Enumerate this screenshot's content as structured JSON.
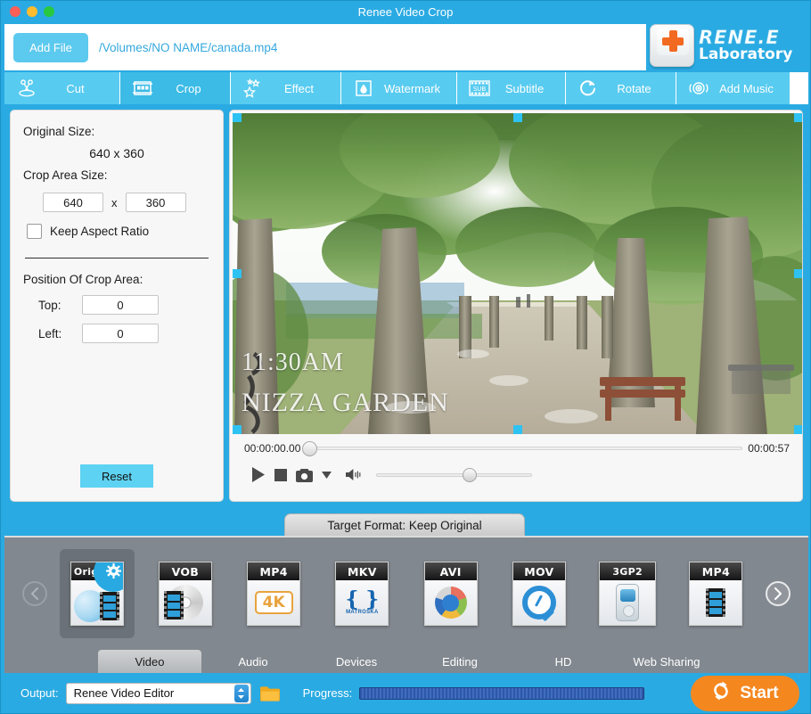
{
  "window": {
    "title": "Renee Video Crop",
    "traffic_lights": [
      "close",
      "minimize",
      "zoom"
    ]
  },
  "filebar": {
    "add_file_label": "Add File",
    "file_path": "/Volumes/NO NAME/canada.mp4"
  },
  "logo": {
    "brand": "RENE.E",
    "subtitle": "Laboratory"
  },
  "nav_tabs": [
    {
      "label": "Cut",
      "icon": "scissors-icon",
      "active": false
    },
    {
      "label": "Crop",
      "icon": "crop-frame-icon",
      "active": true
    },
    {
      "label": "Effect",
      "icon": "stars-icon",
      "active": false
    },
    {
      "label": "Watermark",
      "icon": "watermark-drop-icon",
      "active": false
    },
    {
      "label": "Subtitle",
      "icon": "subtitle-film-icon",
      "active": false
    },
    {
      "label": "Rotate",
      "icon": "rotate-arrow-icon",
      "active": false
    },
    {
      "label": "Add Music",
      "icon": "audio-waves-icon",
      "active": false
    }
  ],
  "crop_panel": {
    "original_size_label": "Original Size:",
    "original_size_value": "640 x 360",
    "crop_area_size_label": "Crop Area Size:",
    "crop_width": "640",
    "crop_height": "360",
    "dimension_separator": "x",
    "keep_aspect_ratio_label": "Keep Aspect Ratio",
    "keep_aspect_ratio_checked": false,
    "position_label": "Position Of Crop Area:",
    "top_label": "Top:",
    "top_value": "0",
    "left_label": "Left:",
    "left_value": "0",
    "reset_label": "Reset"
  },
  "preview": {
    "overlay_time": "11:30AM",
    "overlay_place": "NIZZA GARDEN",
    "current_time": "00:00:00.00",
    "total_time": "00:00:57",
    "seek_position_percent": 0,
    "volume_percent": 55,
    "controls": [
      {
        "name": "play-button",
        "icon": "play-icon"
      },
      {
        "name": "stop-button",
        "icon": "stop-icon"
      },
      {
        "name": "snapshot-button",
        "icon": "camera-icon"
      },
      {
        "name": "snapshot-menu",
        "icon": "chevron-down-icon"
      },
      {
        "name": "volume-button",
        "icon": "speaker-icon"
      }
    ]
  },
  "target_format": {
    "tab_label": "Target Format: Keep Original",
    "prev_arrow": "chevron-left-icon",
    "next_arrow": "chevron-right-icon",
    "items": [
      {
        "label": "Original",
        "selected": true,
        "badge": "gear-icon",
        "art": "globe-film"
      },
      {
        "label": "VOB",
        "selected": false,
        "badge": "",
        "art": "disc-film"
      },
      {
        "label": "MP4",
        "selected": false,
        "badge": "",
        "art": "4k"
      },
      {
        "label": "MKV",
        "selected": false,
        "badge": "",
        "art": "matroska"
      },
      {
        "label": "AVI",
        "selected": false,
        "badge": "",
        "art": "color-wheel"
      },
      {
        "label": "MOV",
        "selected": false,
        "badge": "",
        "art": "quicktime"
      },
      {
        "label": "3GP2",
        "selected": false,
        "badge": "",
        "art": "handheld"
      },
      {
        "label": "MP4",
        "selected": false,
        "badge": "",
        "art": "film"
      }
    ]
  },
  "category_tabs": [
    {
      "label": "Video",
      "active": true
    },
    {
      "label": "Audio",
      "active": false
    },
    {
      "label": "Devices",
      "active": false
    },
    {
      "label": "Editing",
      "active": false
    },
    {
      "label": "HD",
      "active": false
    },
    {
      "label": "Web Sharing",
      "active": false
    }
  ],
  "output_bar": {
    "output_label": "Output:",
    "output_value": "Renee Video Editor",
    "folder_icon": "folder-icon",
    "progress_label": "Progress:",
    "progress_percent": 100,
    "start_label": "Start",
    "start_icon": "refresh-cycle-icon"
  },
  "colors": {
    "accent_blue": "#2aaae2",
    "tab_blue": "#58cbf0",
    "tab_active_blue": "#3bbbe6",
    "handle_blue": "#2ec2f3",
    "start_orange": "#f5871f",
    "strip_gray": "#82888f",
    "progress_blue": "#2e58a8"
  }
}
